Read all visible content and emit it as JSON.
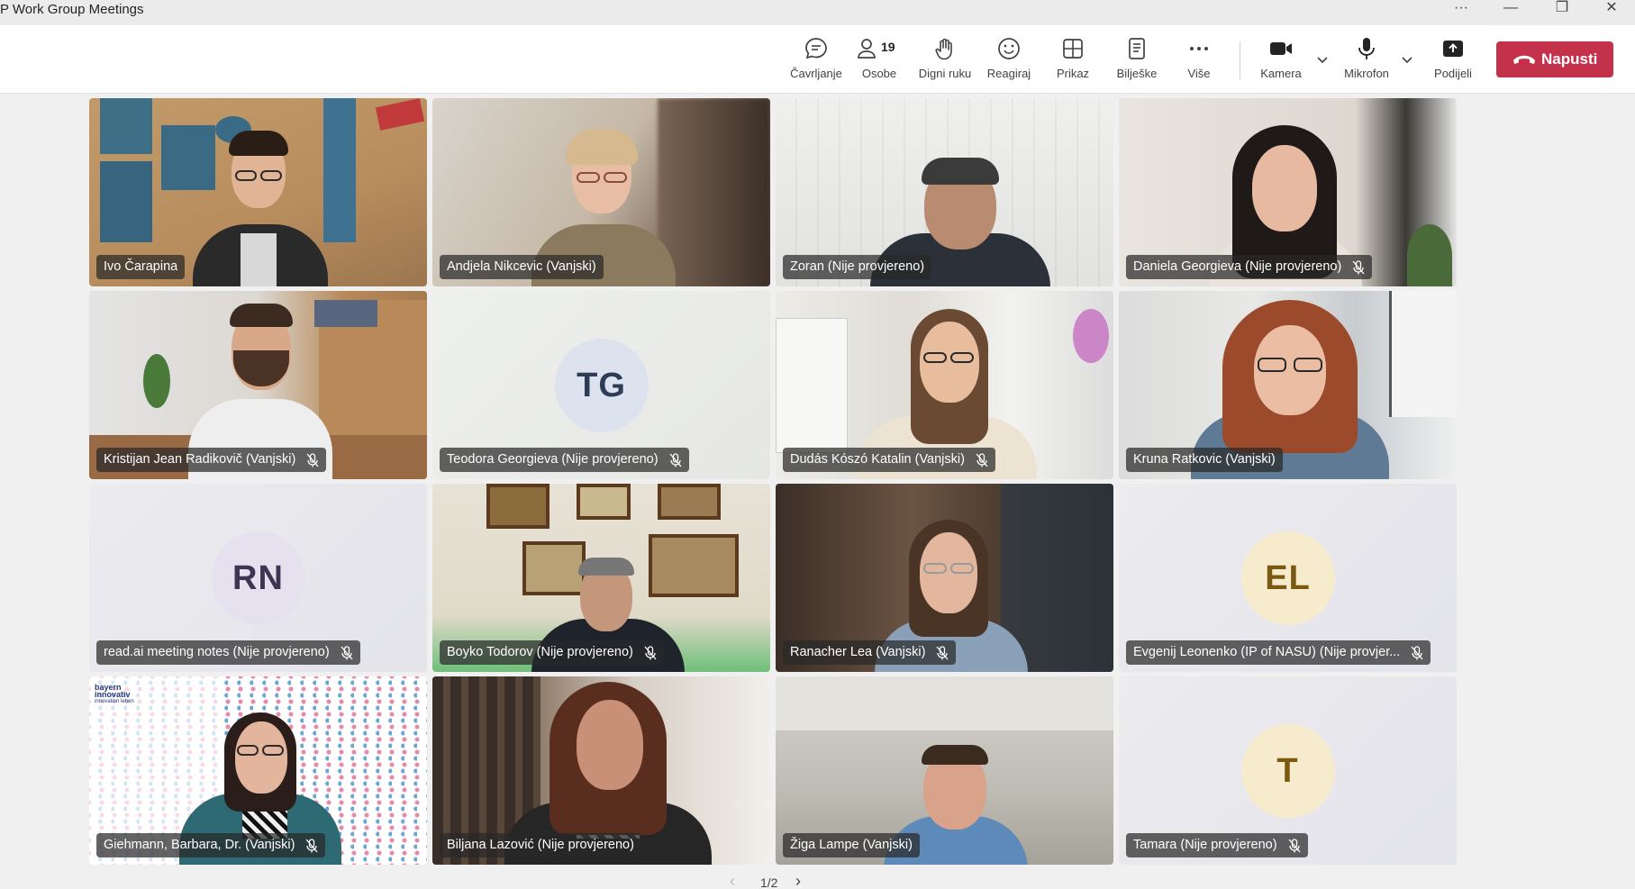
{
  "window": {
    "title": "P Work Group Meetings",
    "controls": [
      "···",
      "—",
      "❐",
      "✕"
    ]
  },
  "toolbar": {
    "chat_label": "Čavrljanje",
    "people_label": "Osobe",
    "people_count": "19",
    "raise_hand_label": "Digni ruku",
    "react_label": "Reagiraj",
    "view_label": "Prikaz",
    "notes_label": "Bilješke",
    "more_label": "Više",
    "camera_label": "Kamera",
    "mic_label": "Mikrofon",
    "share_label": "Podijeli",
    "leave_label": "Napusti"
  },
  "participants": [
    {
      "name": "Ivo Čarapina",
      "muted": false,
      "video": true
    },
    {
      "name": "Andjela Nikcevic (Vanjski)",
      "muted": false,
      "video": true
    },
    {
      "name": "Zoran (Nije provjereno)",
      "muted": false,
      "video": true
    },
    {
      "name": "Daniela Georgieva (Nije provjereno)",
      "muted": true,
      "video": true
    },
    {
      "name": "Kristijan Jean Radikovič (Vanjski)",
      "muted": true,
      "video": true
    },
    {
      "name": "Teodora Georgieva (Nije provjereno)",
      "muted": true,
      "video": false,
      "initials": "TG"
    },
    {
      "name": "Dudás Kószó Katalin (Vanjski)",
      "muted": true,
      "video": true
    },
    {
      "name": "Kruna Ratkovic (Vanjski)",
      "muted": false,
      "video": true
    },
    {
      "name": "read.ai meeting notes (Nije provjereno)",
      "muted": true,
      "video": false,
      "initials": "RN"
    },
    {
      "name": "Boyko Todorov (Nije provjereno)",
      "muted": true,
      "video": true
    },
    {
      "name": "Ranacher Lea (Vanjski)",
      "muted": true,
      "video": true
    },
    {
      "name": "Evgenij Leonenko (IP of NASU) (Nije provjer...",
      "muted": true,
      "video": false,
      "initials": "EL"
    },
    {
      "name": "Giehmann, Barbara, Dr. (Vanjski)",
      "muted": true,
      "video": true
    },
    {
      "name": "Biljana Lazović (Nije provjereno)",
      "muted": false,
      "video": true
    },
    {
      "name": "Žiga Lampe (Vanjski)",
      "muted": false,
      "video": true
    },
    {
      "name": "Tamara (Nije provjereno)",
      "muted": true,
      "video": false,
      "initials": "T"
    }
  ],
  "background_logo": {
    "line1": "bayern",
    "line2": "innovativ",
    "line3": "innovation leben"
  },
  "pager": {
    "label": "1/2",
    "prev": "‹",
    "next": "›"
  },
  "colors": {
    "leave": "#c4314b",
    "avatar_tg": "#dce3ee",
    "avatar_rn": "#e6e1ef",
    "avatar_el": "#f6ebcc",
    "avatar_t": "#f6ebcc"
  },
  "icons": {
    "chat": "chat-bubble-icon",
    "people": "people-icon",
    "hand": "raise-hand-icon",
    "react": "smiley-icon",
    "view": "grid-view-icon",
    "notes": "notes-icon",
    "more": "more-dots-icon",
    "camera": "video-camera-icon",
    "mic": "microphone-icon",
    "share": "share-screen-icon",
    "leave": "phone-hangup-icon",
    "muted": "mic-off-icon"
  }
}
